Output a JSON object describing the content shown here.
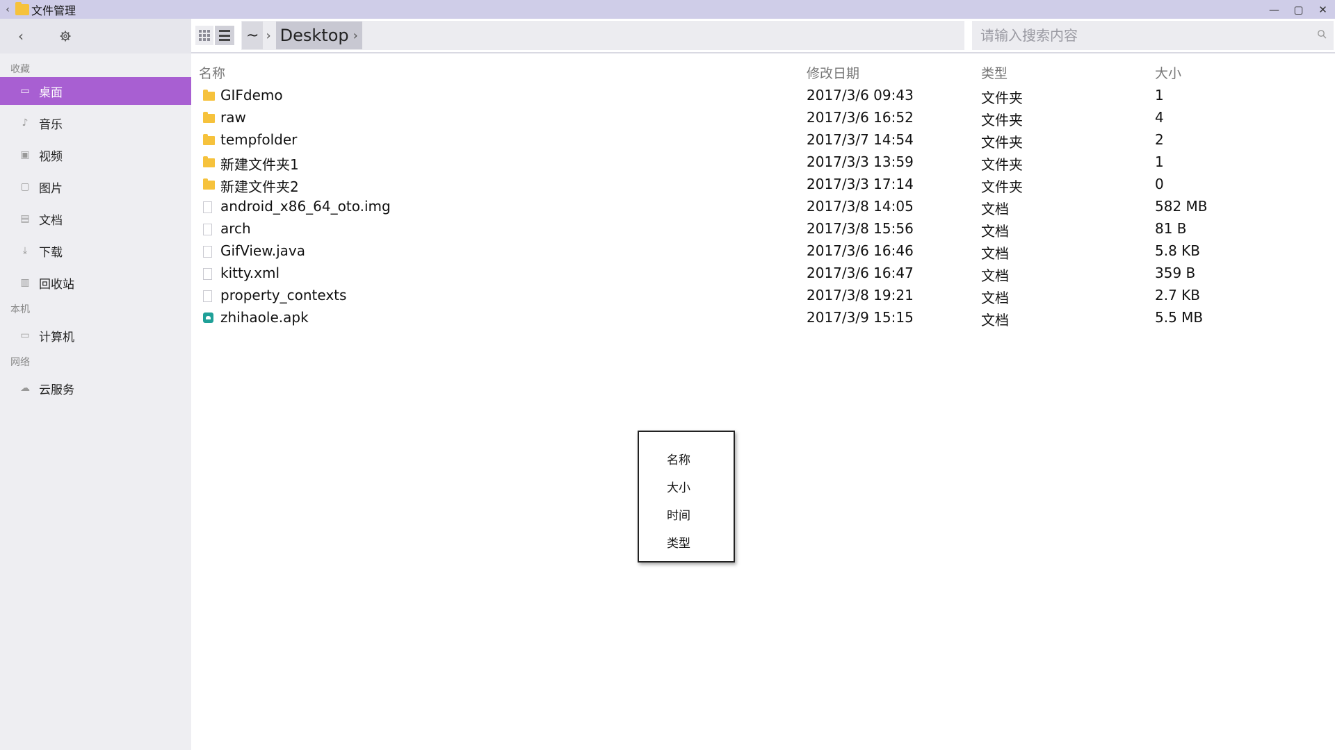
{
  "window": {
    "title": "文件管理",
    "back_glyph": "‹",
    "controls": {
      "minimize": "—",
      "maximize": "▢",
      "close": "✕"
    }
  },
  "toolbar": {
    "back_glyph": "‹",
    "breadcrumb": {
      "home": "~",
      "separator": "›",
      "current": "Desktop"
    },
    "search_placeholder": "请输入搜索内容"
  },
  "sidebar": {
    "sections": [
      {
        "label": "收藏",
        "items": [
          {
            "label": "桌面",
            "icon": "desktop-icon",
            "active": true
          },
          {
            "label": "音乐",
            "icon": "music-icon"
          },
          {
            "label": "视频",
            "icon": "video-icon"
          },
          {
            "label": "图片",
            "icon": "picture-icon"
          },
          {
            "label": "文档",
            "icon": "document-icon"
          },
          {
            "label": "下载",
            "icon": "download-icon"
          },
          {
            "label": "回收站",
            "icon": "trash-icon"
          }
        ]
      },
      {
        "label": "本机",
        "items": [
          {
            "label": "计算机",
            "icon": "computer-icon"
          }
        ]
      },
      {
        "label": "网络",
        "items": [
          {
            "label": "云服务",
            "icon": "cloud-icon"
          }
        ]
      }
    ]
  },
  "table": {
    "headers": {
      "name": "名称",
      "date": "修改日期",
      "type": "类型",
      "size": "大小"
    },
    "rows": [
      {
        "name": "GIFdemo",
        "date": "2017/3/6 09:43",
        "type": "文件夹",
        "size": "1",
        "icon": "folder-icon"
      },
      {
        "name": "raw",
        "date": "2017/3/6 16:52",
        "type": "文件夹",
        "size": "4",
        "icon": "folder-icon"
      },
      {
        "name": "tempfolder",
        "date": "2017/3/7 14:54",
        "type": "文件夹",
        "size": "2",
        "icon": "folder-icon"
      },
      {
        "name": "新建文件夹1",
        "date": "2017/3/3 13:59",
        "type": "文件夹",
        "size": "1",
        "icon": "folder-icon"
      },
      {
        "name": "新建文件夹2",
        "date": "2017/3/3 17:14",
        "type": "文件夹",
        "size": "0",
        "icon": "folder-icon"
      },
      {
        "name": "android_x86_64_oto.img",
        "date": "2017/3/8 14:05",
        "type": "文档",
        "size": "582 MB",
        "icon": "file-icon"
      },
      {
        "name": "arch",
        "date": "2017/3/8 15:56",
        "type": "文档",
        "size": "81 B",
        "icon": "file-icon"
      },
      {
        "name": "GifView.java",
        "date": "2017/3/6 16:46",
        "type": "文档",
        "size": "5.8 KB",
        "icon": "file-icon"
      },
      {
        "name": "kitty.xml",
        "date": "2017/3/6 16:47",
        "type": "文档",
        "size": "359 B",
        "icon": "file-icon"
      },
      {
        "name": "property_contexts",
        "date": "2017/3/8 19:21",
        "type": "文档",
        "size": "2.7 KB",
        "icon": "file-icon"
      },
      {
        "name": "zhihaole.apk",
        "date": "2017/3/9 15:15",
        "type": "文档",
        "size": "5.5 MB",
        "icon": "apk-icon"
      }
    ]
  },
  "context_menu": {
    "items": [
      "名称",
      "大小",
      "时间",
      "类型"
    ]
  },
  "colors": {
    "titlebar": "#cfcde8",
    "sidebar_active": "#a85fd2",
    "folder": "#f6c23c",
    "apk": "#1fa098"
  }
}
